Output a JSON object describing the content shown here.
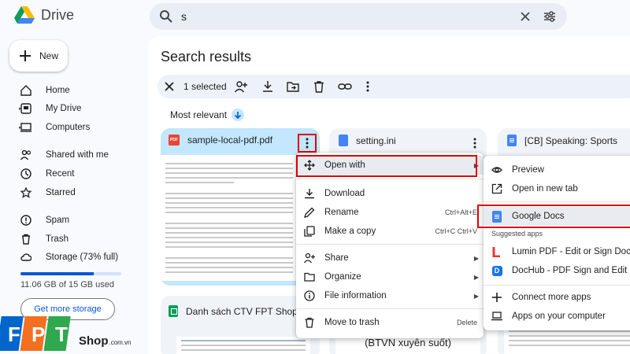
{
  "app": {
    "name": "Drive"
  },
  "search": {
    "query": "s"
  },
  "nav": {
    "new_label": "New",
    "items": [
      "Home",
      "My Drive",
      "Computers",
      "Shared with me",
      "Recent",
      "Starred",
      "Spam",
      "Trash",
      "Storage (73% full)"
    ],
    "storage_used_fraction": 0.73,
    "storage_text": "11.06 GB of 15 GB used",
    "get_storage_label": "Get more storage"
  },
  "page": {
    "title": "Search results",
    "selection_count": "1 selected",
    "sort_label": "Most relevant"
  },
  "files": [
    {
      "name": "sample-local-pdf.pdf",
      "type": "pdf",
      "selected": true
    },
    {
      "name": "setting.ini",
      "type": "doc"
    },
    {
      "name": "[CB] Speaking: Sports",
      "type": "gdoc"
    },
    {
      "name": "Danh sách CTV FPT Shop",
      "type": "sheet"
    },
    {
      "name": "(BTVN xuyên suốt)",
      "type": "gdoc"
    }
  ],
  "context_menu": {
    "open_with": "Open with",
    "download": "Download",
    "rename": "Rename",
    "rename_shortcut": "Ctrl+Alt+E",
    "make_copy": "Make a copy",
    "make_copy_shortcut": "Ctrl+C Ctrl+V",
    "share": "Share",
    "organize": "Organize",
    "file_information": "File information",
    "move_to_trash": "Move to trash",
    "delete_shortcut": "Delete"
  },
  "submenu": {
    "preview": "Preview",
    "open_new_tab": "Open in new tab",
    "google_docs": "Google Docs",
    "suggested_header": "Suggested apps",
    "lumin": "Lumin PDF - Edit or Sign Docum",
    "dochub": "DocHub - PDF Sign and Edit",
    "connect_more": "Connect more apps",
    "apps_on_computer": "Apps on your computer"
  },
  "watermark": {
    "fpt": "FPT",
    "shop": "Shop",
    "domain": ".com.vn"
  },
  "colors": {
    "accent": "#0b57d0",
    "selected": "#c2e7ff",
    "highlight_box": "#e00000",
    "fpt_blue": "#0066cc"
  }
}
